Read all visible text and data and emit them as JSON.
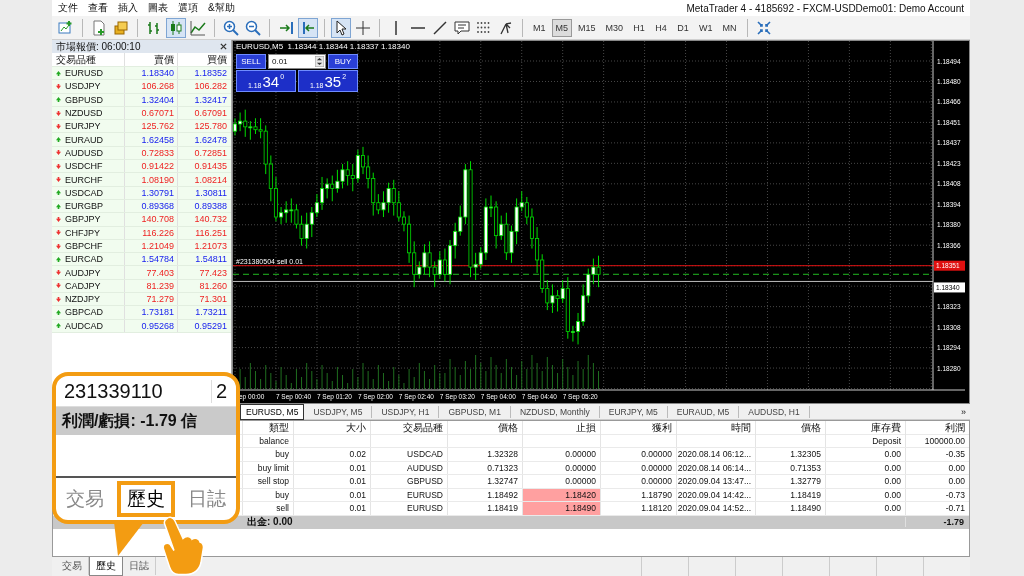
{
  "menu": [
    "文件",
    "查看",
    "插入",
    "圖表",
    "選項",
    "&幫助"
  ],
  "window": {
    "title": "MetaTrader 4 - 4185692 - FXCM-USDDemo01: Demo Account"
  },
  "tools": [
    {
      "kind": "new_chart",
      "selected": false
    },
    {
      "kind": "separator"
    },
    {
      "kind": "page",
      "selected": false
    },
    {
      "kind": "stack",
      "selected": false
    },
    {
      "kind": "separator"
    },
    {
      "kind": "bar_chart",
      "selected": false
    },
    {
      "kind": "candles",
      "selected": true
    },
    {
      "kind": "line_chart",
      "selected": false
    },
    {
      "kind": "separator"
    },
    {
      "kind": "zoom_in",
      "selected": false
    },
    {
      "kind": "zoom_out",
      "selected": false
    },
    {
      "kind": "separator"
    },
    {
      "kind": "autoscroll",
      "selected": false
    },
    {
      "kind": "chart_shift",
      "selected": true
    },
    {
      "kind": "separator"
    },
    {
      "kind": "cursor",
      "selected": true
    },
    {
      "kind": "crosshair",
      "selected": false
    },
    {
      "kind": "separator"
    },
    {
      "kind": "vline",
      "selected": false
    },
    {
      "kind": "hline",
      "selected": false
    },
    {
      "kind": "trendline",
      "selected": false
    },
    {
      "kind": "text",
      "selected": false
    },
    {
      "kind": "dots",
      "selected": false
    },
    {
      "kind": "fork",
      "selected": false
    }
  ],
  "timeframes": [
    {
      "label": "M1",
      "selected": false
    },
    {
      "label": "M5",
      "selected": true
    },
    {
      "label": "M15",
      "selected": false
    },
    {
      "label": "M30",
      "selected": false
    },
    {
      "label": "H1",
      "selected": false
    },
    {
      "label": "H4",
      "selected": false
    },
    {
      "label": "D1",
      "selected": false
    },
    {
      "label": "W1",
      "selected": false
    },
    {
      "label": "MN",
      "selected": false
    }
  ],
  "market_watch": {
    "title": "市場報價: 06:00:10",
    "columns": [
      "交易品種",
      "賣價",
      "買價"
    ],
    "rows": [
      {
        "symbol": "EURUSD",
        "bid": "1.18340",
        "ask": "1.18352",
        "kind": "up"
      },
      {
        "symbol": "USDJPY",
        "bid": "106.268",
        "ask": "106.282",
        "kind": "down"
      },
      {
        "symbol": "GBPUSD",
        "bid": "1.32404",
        "ask": "1.32417",
        "kind": "up"
      },
      {
        "symbol": "NZDUSD",
        "bid": "0.67071",
        "ask": "0.67091",
        "kind": "down"
      },
      {
        "symbol": "EURJPY",
        "bid": "125.762",
        "ask": "125.780",
        "kind": "down"
      },
      {
        "symbol": "EURAUD",
        "bid": "1.62458",
        "ask": "1.62478",
        "kind": "up"
      },
      {
        "symbol": "AUDUSD",
        "bid": "0.72833",
        "ask": "0.72851",
        "kind": "down"
      },
      {
        "symbol": "USDCHF",
        "bid": "0.91422",
        "ask": "0.91435",
        "kind": "down"
      },
      {
        "symbol": "EURCHF",
        "bid": "1.08190",
        "ask": "1.08214",
        "kind": "down"
      },
      {
        "symbol": "USDCAD",
        "bid": "1.30791",
        "ask": "1.30811",
        "kind": "up"
      },
      {
        "symbol": "EURGBP",
        "bid": "0.89368",
        "ask": "0.89388",
        "kind": "up"
      },
      {
        "symbol": "GBPJPY",
        "bid": "140.708",
        "ask": "140.732",
        "kind": "down"
      },
      {
        "symbol": "CHFJPY",
        "bid": "116.226",
        "ask": "116.251",
        "kind": "down"
      },
      {
        "symbol": "GBPCHF",
        "bid": "1.21049",
        "ask": "1.21073",
        "kind": "down"
      },
      {
        "symbol": "EURCAD",
        "bid": "1.54784",
        "ask": "1.54811",
        "kind": "up"
      },
      {
        "symbol": "AUDJPY",
        "bid": "77.403",
        "ask": "77.423",
        "kind": "down"
      },
      {
        "symbol": "CADJPY",
        "bid": "81.239",
        "ask": "81.260",
        "kind": "down"
      },
      {
        "symbol": "NZDJPY",
        "bid": "71.279",
        "ask": "71.301",
        "kind": "down"
      },
      {
        "symbol": "GBPCAD",
        "bid": "1.73181",
        "ask": "1.73211",
        "kind": "up"
      },
      {
        "symbol": "AUDCAD",
        "bid": "0.95268",
        "ask": "0.95291",
        "kind": "up"
      }
    ]
  },
  "chart": {
    "header": "EURUSD,M5  1.18344 1.18344 1.18337 1.18340",
    "trade_panel": {
      "sell": "SELL",
      "buy": "BUY",
      "lot": "0.01",
      "sell_price": {
        "base": "1.18",
        "big": "34",
        "small": "0"
      },
      "buy_price": {
        "base": "1.18",
        "big": "35",
        "small": "2"
      }
    },
    "order_label": "#231380504 sell 0.01",
    "price_labels": [
      "1.18494",
      "1.18480",
      "1.18466",
      "1.18451",
      "1.18437",
      "1.18423",
      "1.18408",
      "1.18394",
      "1.18380",
      "1.18366",
      "1.18323",
      "1.18308",
      "1.18294",
      "1.18280"
    ],
    "stop_tag": "1.18351",
    "bid_tag": "1.18340",
    "time_labels": [
      "ep 00:00",
      "7 Sep 00:40",
      "7 Sep 01:20",
      "7 Sep 02:00",
      "7 Sep 02:40",
      "7 Sep 03:20",
      "7 Sep 04:00",
      "7 Sep 04:40",
      "7 Sep 05:20"
    ]
  },
  "chart_tabs": [
    {
      "label": "EURUSD, M5",
      "selected": true
    },
    {
      "label": "USDJPY, M5",
      "selected": false
    },
    {
      "label": "USDJPY, H1",
      "selected": false
    },
    {
      "label": "GBPUSD, M1",
      "selected": false
    },
    {
      "label": "NZDUSD, Monthly",
      "selected": false
    },
    {
      "label": "EURJPY, M5",
      "selected": false
    },
    {
      "label": "EURAUD, M5",
      "selected": false
    },
    {
      "label": "AUDUSD, H1",
      "selected": false
    }
  ],
  "chart_tabs_more": "»",
  "terminal": {
    "columns": [
      "類型",
      "大小",
      "交易品種",
      "價格",
      "止損",
      "獲利",
      "時間",
      "價格",
      "庫存費",
      "利潤"
    ],
    "rows": [
      {
        "type": "balance",
        "swap": "Deposit",
        "profit": "100000.00",
        "sl_highlight": false
      },
      {
        "type": "buy",
        "size": "0.02",
        "symbol": "USDCAD",
        "price": "1.32328",
        "sl": "0.00000",
        "tp": "0.00000",
        "time": "2020.08.14 06:12...",
        "close_price": "1.32305",
        "swap": "0.00",
        "profit": "-0.35",
        "sl_highlight": false
      },
      {
        "type": "buy limit",
        "size": "0.01",
        "symbol": "AUDUSD",
        "price": "0.71323",
        "sl": "0.00000",
        "tp": "0.00000",
        "time": "2020.08.14 06:14...",
        "close_price": "0.71353",
        "swap": "0.00",
        "profit": "0.00",
        "sl_highlight": false
      },
      {
        "type": "sell stop",
        "size": "0.01",
        "symbol": "GBPUSD",
        "price": "1.32747",
        "sl": "0.00000",
        "tp": "0.00000",
        "time": "2020.09.04 13:47...",
        "close_price": "1.32779",
        "swap": "0.00",
        "profit": "0.00",
        "sl_highlight": false
      },
      {
        "type": "buy",
        "size": "0.01",
        "symbol": "EURUSD",
        "price": "1.18492",
        "sl": "1.18420",
        "tp": "1.18790",
        "time": "2020.09.04 14:42...",
        "close_price": "1.18419",
        "swap": "0.00",
        "profit": "-0.73",
        "sl_highlight": true
      },
      {
        "type": "sell",
        "size": "0.01",
        "symbol": "EURUSD",
        "price": "1.18419",
        "sl": "1.18490",
        "tp": "1.18120",
        "time": "2020.09.04 14:52...",
        "close_price": "1.18490",
        "swap": "0.00",
        "profit": "-0.71",
        "sl_highlight": true
      }
    ],
    "total": {
      "withdrawal": "出金: 0.00",
      "profit": "-1.79"
    }
  },
  "bottom_tabs": [
    {
      "label": "交易",
      "selected": false
    },
    {
      "label": "歷史",
      "selected": true
    },
    {
      "label": "日誌",
      "selected": false
    }
  ],
  "callout": {
    "order": "231339110",
    "next_cell": "2",
    "summary": "利潤/虧損: -1.79 信",
    "tabs": [
      {
        "label": "交易",
        "selected": false
      },
      {
        "label": "歷史",
        "selected": true
      },
      {
        "label": "日誌",
        "selected": false
      }
    ]
  }
}
